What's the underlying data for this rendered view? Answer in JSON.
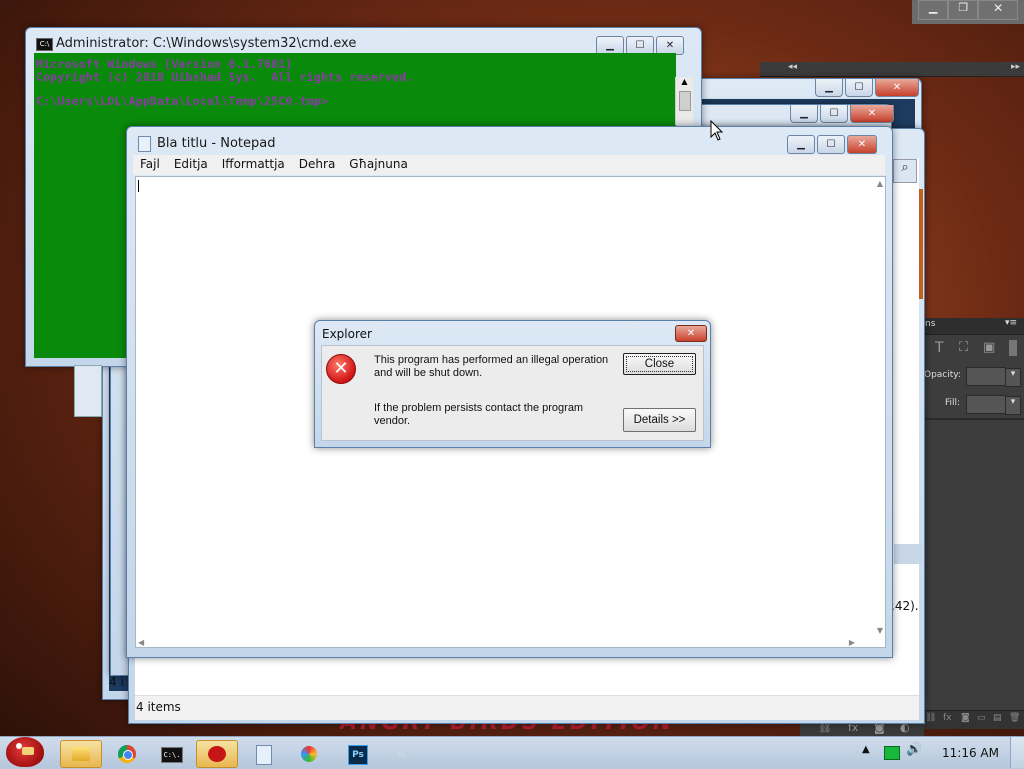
{
  "cmd": {
    "title": "Administrator: C:\\Windows\\system32\\cmd.exe",
    "lines": [
      "Microsoft Windows [Version 6.1.7601]",
      "Copyright (c) 2018 Uibshad Sys.  All rights reserved.",
      "C:\\Users\\LOL\\AppData\\Local\\Temp\\25C0.tmp>"
    ],
    "console_color": "#0a8a0a"
  },
  "notepad": {
    "title": "Bla titlu - Notepad",
    "menu": [
      "Fajl",
      "Editja",
      "Ifformattja",
      "Dehra",
      "Għajnuna"
    ]
  },
  "dialog": {
    "title": "Explorer",
    "message": "This program has performed an illegal operation and will be shut down.",
    "message_line1": "This program has performed an illegal operation",
    "message_line2": "and will be shut down.",
    "hint_line1": "If the problem persists contact the program",
    "hint_line2": "vendor.",
    "close_label": "Close",
    "details_label": "Details >>",
    "icon": "error-icon"
  },
  "explorer_bg": {
    "status": "4 items",
    "cut_status": "4 i",
    "cut_text": ".42)."
  },
  "photoshop": {
    "opacity_label": "Opacity:",
    "fill_label": "Fill:",
    "tab_fragment": "ns"
  },
  "game_banner": "ANGRY BIRDS EDITION",
  "taskbar": {
    "clock": "11:16 AM",
    "apps": [
      "angry-birds-icon",
      "explorer-icon",
      "chrome-icon",
      "cmd-icon",
      "angry-birds-app-icon",
      "notepad-icon",
      "paint-icon",
      "photoshop-icon",
      "blank-icon"
    ],
    "ps_label": "Ps",
    "cmd_label": "C:\\."
  }
}
